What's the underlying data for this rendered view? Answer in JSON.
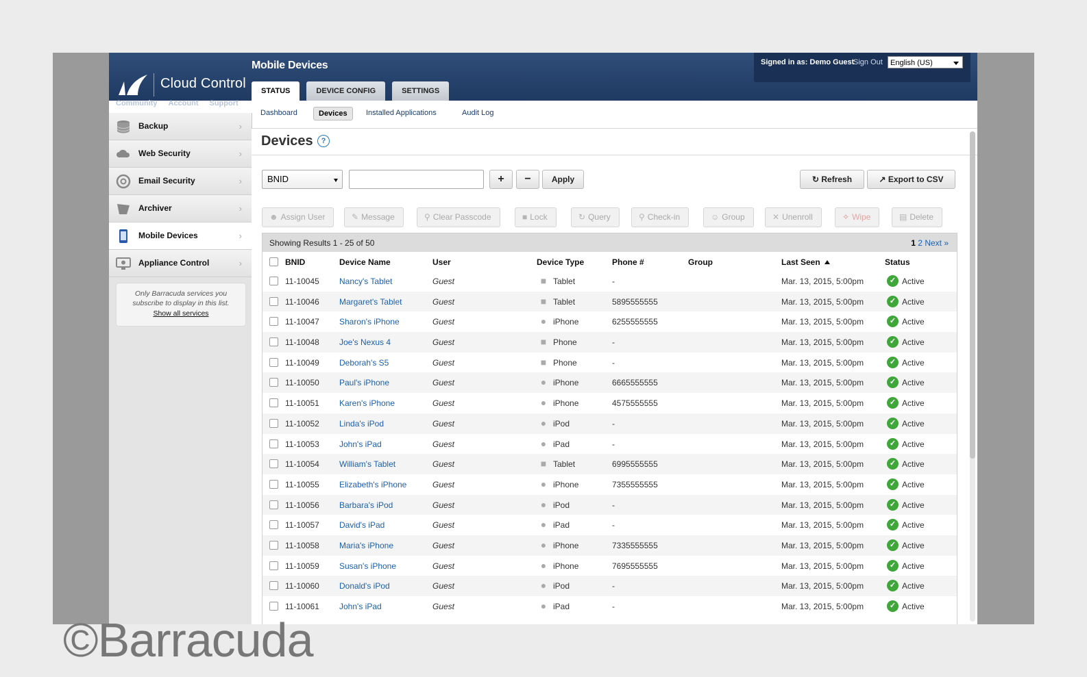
{
  "header": {
    "brand": "Cloud Control",
    "top_links": [
      "Community",
      "Account",
      "Support"
    ],
    "app_title": "Mobile Devices",
    "signed_in_label": "Signed in as:",
    "user_name": "Demo Guest",
    "sign_out": "Sign Out",
    "language": "English (US)",
    "tabs": [
      "STATUS",
      "DEVICE CONFIG",
      "SETTINGS"
    ],
    "active_tab": "STATUS"
  },
  "subnav": {
    "items": [
      "Dashboard",
      "Devices",
      "Installed Applications",
      "Audit Log"
    ],
    "active": "Devices"
  },
  "sidebar": {
    "items": [
      {
        "label": "Backup",
        "icon": "database-icon"
      },
      {
        "label": "Web Security",
        "icon": "cloud-icon"
      },
      {
        "label": "Email Security",
        "icon": "at-sign-icon"
      },
      {
        "label": "Archiver",
        "icon": "archive-icon"
      },
      {
        "label": "Mobile Devices",
        "icon": "mobile-device-icon"
      },
      {
        "label": "Appliance Control",
        "icon": "monitor-icon"
      }
    ],
    "active": "Mobile Devices",
    "note": "Only Barracuda services you subscribe to display in this list.",
    "show_all": "Show all services"
  },
  "main": {
    "heading": "Devices",
    "help": "?",
    "filter": {
      "field": "BNID",
      "value": "",
      "add": "+",
      "remove": "−",
      "apply": "Apply"
    },
    "refresh": "Refresh",
    "export": "Export to CSV",
    "actions": [
      "Assign User",
      "Message",
      "Clear Passcode",
      "Lock",
      "Query",
      "Check-in",
      "Group",
      "Unenroll",
      "Wipe",
      "Delete"
    ],
    "results_text": "Showing Results 1 - 25 of 50",
    "pagination": {
      "current": "1",
      "next_page": "2",
      "next": "Next »"
    },
    "columns": [
      "BNID",
      "Device Name",
      "User",
      "Device Type",
      "Phone #",
      "Group",
      "Last Seen",
      "Status"
    ],
    "rows": [
      {
        "bnid": "11-10045",
        "name": "Nancy's Tablet",
        "user": "Guest",
        "type": "Tablet",
        "os": "android",
        "phone": "-",
        "group": "",
        "seen": "Mar. 13, 2015, 5:00pm",
        "status": "Active"
      },
      {
        "bnid": "11-10046",
        "name": "Margaret's Tablet",
        "user": "Guest",
        "type": "Tablet",
        "os": "android",
        "phone": "5895555555",
        "group": "",
        "seen": "Mar. 13, 2015, 5:00pm",
        "status": "Active"
      },
      {
        "bnid": "11-10047",
        "name": "Sharon's iPhone",
        "user": "Guest",
        "type": "iPhone",
        "os": "apple",
        "phone": "6255555555",
        "group": "",
        "seen": "Mar. 13, 2015, 5:00pm",
        "status": "Active"
      },
      {
        "bnid": "11-10048",
        "name": "Joe's Nexus 4",
        "user": "Guest",
        "type": "Phone",
        "os": "android",
        "phone": "-",
        "group": "",
        "seen": "Mar. 13, 2015, 5:00pm",
        "status": "Active"
      },
      {
        "bnid": "11-10049",
        "name": "Deborah's S5",
        "user": "Guest",
        "type": "Phone",
        "os": "android",
        "phone": "-",
        "group": "",
        "seen": "Mar. 13, 2015, 5:00pm",
        "status": "Active"
      },
      {
        "bnid": "11-10050",
        "name": "Paul's iPhone",
        "user": "Guest",
        "type": "iPhone",
        "os": "apple",
        "phone": "6665555555",
        "group": "",
        "seen": "Mar. 13, 2015, 5:00pm",
        "status": "Active"
      },
      {
        "bnid": "11-10051",
        "name": "Karen's iPhone",
        "user": "Guest",
        "type": "iPhone",
        "os": "apple",
        "phone": "4575555555",
        "group": "",
        "seen": "Mar. 13, 2015, 5:00pm",
        "status": "Active"
      },
      {
        "bnid": "11-10052",
        "name": "Linda's iPod",
        "user": "Guest",
        "type": "iPod",
        "os": "apple",
        "phone": "-",
        "group": "",
        "seen": "Mar. 13, 2015, 5:00pm",
        "status": "Active"
      },
      {
        "bnid": "11-10053",
        "name": "John's iPad",
        "user": "Guest",
        "type": "iPad",
        "os": "apple",
        "phone": "-",
        "group": "",
        "seen": "Mar. 13, 2015, 5:00pm",
        "status": "Active"
      },
      {
        "bnid": "11-10054",
        "name": "William's Tablet",
        "user": "Guest",
        "type": "Tablet",
        "os": "android",
        "phone": "6995555555",
        "group": "",
        "seen": "Mar. 13, 2015, 5:00pm",
        "status": "Active"
      },
      {
        "bnid": "11-10055",
        "name": "Elizabeth's iPhone",
        "user": "Guest",
        "type": "iPhone",
        "os": "apple",
        "phone": "7355555555",
        "group": "",
        "seen": "Mar. 13, 2015, 5:00pm",
        "status": "Active"
      },
      {
        "bnid": "11-10056",
        "name": "Barbara's iPod",
        "user": "Guest",
        "type": "iPod",
        "os": "apple",
        "phone": "-",
        "group": "",
        "seen": "Mar. 13, 2015, 5:00pm",
        "status": "Active"
      },
      {
        "bnid": "11-10057",
        "name": "David's iPad",
        "user": "Guest",
        "type": "iPad",
        "os": "apple",
        "phone": "-",
        "group": "",
        "seen": "Mar. 13, 2015, 5:00pm",
        "status": "Active"
      },
      {
        "bnid": "11-10058",
        "name": "Maria's iPhone",
        "user": "Guest",
        "type": "iPhone",
        "os": "apple",
        "phone": "7335555555",
        "group": "",
        "seen": "Mar. 13, 2015, 5:00pm",
        "status": "Active"
      },
      {
        "bnid": "11-10059",
        "name": "Susan's iPhone",
        "user": "Guest",
        "type": "iPhone",
        "os": "apple",
        "phone": "7695555555",
        "group": "",
        "seen": "Mar. 13, 2015, 5:00pm",
        "status": "Active"
      },
      {
        "bnid": "11-10060",
        "name": "Donald's iPod",
        "user": "Guest",
        "type": "iPod",
        "os": "apple",
        "phone": "-",
        "group": "",
        "seen": "Mar. 13, 2015, 5:00pm",
        "status": "Active"
      },
      {
        "bnid": "11-10061",
        "name": "John's iPad",
        "user": "Guest",
        "type": "iPad",
        "os": "apple",
        "phone": "-",
        "group": "",
        "seen": "Mar. 13, 2015, 5:00pm",
        "status": "Active"
      }
    ]
  },
  "colors": {
    "header": "#1f3a63",
    "link": "#1e5fa8",
    "active_status": "#3fa63a"
  },
  "watermark": "©Barracuda"
}
